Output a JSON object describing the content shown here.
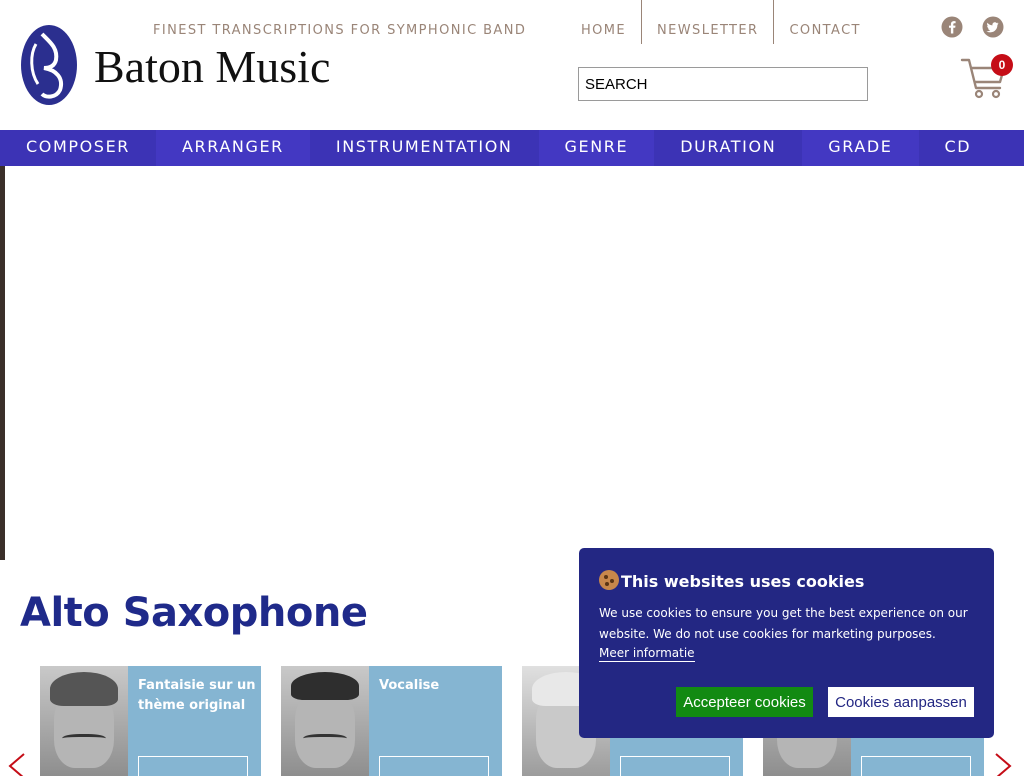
{
  "header": {
    "brand": "Baton Music",
    "tagline": "FINEST TRANSCRIPTIONS FOR SYMPHONIC BAND",
    "topnav": [
      "HOME",
      "NEWSLETTER",
      "CONTACT"
    ],
    "search_placeholder": "SEARCH",
    "social_icons": [
      "facebook-icon",
      "twitter-icon"
    ],
    "cart_count": "0"
  },
  "mainnav": [
    "COMPOSER",
    "ARRANGER",
    "INSTRUMENTATION",
    "GENRE",
    "DURATION",
    "GRADE",
    "CD"
  ],
  "colors": {
    "nav": "#3c33b5",
    "title": "#1f2a8a",
    "card": "#85b5d2",
    "cookie_bg": "#232783",
    "accept": "#128a12",
    "badge": "#c50d17",
    "muted_text": "#9a8578"
  },
  "section": {
    "title": "Alto Saxophone",
    "cards": [
      {
        "title": "Fantaisie sur un thème original"
      },
      {
        "title": "Vocalise"
      },
      {
        "title": ""
      },
      {
        "title": ""
      }
    ]
  },
  "cookie": {
    "title": "This websites uses cookies",
    "text": "We use cookies to ensure you get the best experience on our website. We do not use cookies for marketing purposes.",
    "more": "Meer informatie",
    "accept": "Accepteer cookies",
    "customize": "Cookies aanpassen"
  }
}
